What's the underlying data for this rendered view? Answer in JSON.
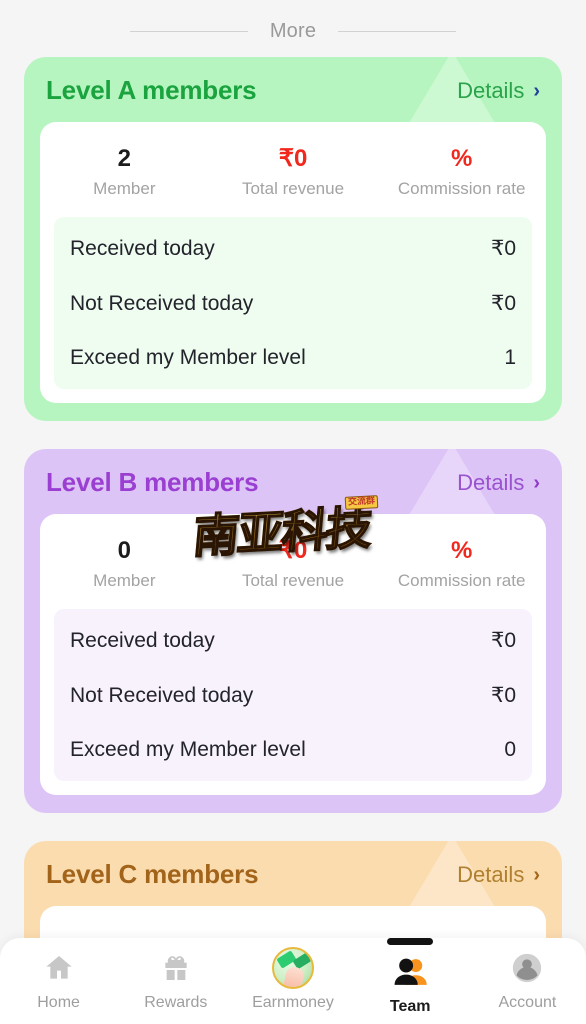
{
  "section_divider": {
    "label": "More"
  },
  "levels": [
    {
      "title": "Level A members",
      "details_label": "Details",
      "chevron": "›",
      "theme": "green",
      "stats": [
        {
          "value": "2",
          "label": "Member",
          "style": "dark"
        },
        {
          "value": "₹0",
          "label": "Total revenue",
          "style": "red"
        },
        {
          "value": "%",
          "label": "Commission rate",
          "style": "red"
        }
      ],
      "rows": [
        {
          "label": "Received today",
          "value": "₹0"
        },
        {
          "label": "Not Received today",
          "value": "₹0"
        },
        {
          "label": "Exceed my Member level",
          "value": "1"
        }
      ]
    },
    {
      "title": "Level B members",
      "details_label": "Details",
      "chevron": "›",
      "theme": "purple",
      "stats": [
        {
          "value": "0",
          "label": "Member",
          "style": "dark"
        },
        {
          "value": "₹0",
          "label": "Total revenue",
          "style": "red"
        },
        {
          "value": "%",
          "label": "Commission rate",
          "style": "red"
        }
      ],
      "rows": [
        {
          "label": "Received today",
          "value": "₹0"
        },
        {
          "label": "Not Received today",
          "value": "₹0"
        },
        {
          "label": "Exceed my Member level",
          "value": "0"
        }
      ]
    },
    {
      "title": "Level C members",
      "details_label": "Details",
      "chevron": "›",
      "theme": "orange",
      "stats": [],
      "rows": []
    }
  ],
  "watermark": {
    "text": "南亚科技",
    "badge": "交流群"
  },
  "bottom_nav": {
    "items": [
      {
        "label": "Home",
        "icon": "home-icon",
        "active": false
      },
      {
        "label": "Rewards",
        "icon": "gift-icon",
        "active": false
      },
      {
        "label": "Earnmoney",
        "icon": "money-hand-icon",
        "active": false
      },
      {
        "label": "Team",
        "icon": "people-icon",
        "active": true
      },
      {
        "label": "Account",
        "icon": "avatar-icon",
        "active": false
      }
    ]
  },
  "colors": {
    "page_background": "#f5f5f5",
    "green_card": "#b6f5bf",
    "purple_card": "#ddc4f7",
    "orange_card": "#fbdcaf",
    "green_title": "#1aa33f",
    "purple_title": "#9a3fd1",
    "orange_title": "#a2641a",
    "red_value": "#f0281e",
    "chevron_blue": "#21409a",
    "active_nav": "#121212",
    "inactive_nav": "#9e9e9e"
  }
}
